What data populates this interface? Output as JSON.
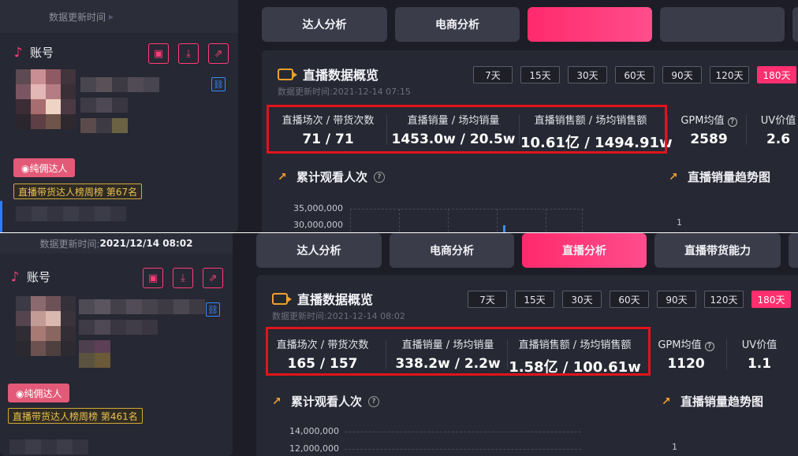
{
  "panels": [
    {
      "update_label": "数据更新时间",
      "update_time": "",
      "account_label": "账号",
      "tag_pink": "◉纯佣达人",
      "tag_gold": "直播带货达人榜周榜 第67名",
      "tabs": [
        "达人分析",
        "电商分析",
        "",
        ""
      ],
      "active_tab": 2,
      "overview_title": "直播数据概览",
      "overview_update": "数据更新时间:2021-12-14 07:15",
      "ranges": [
        "7天",
        "15天",
        "30天",
        "60天",
        "90天",
        "120天",
        "180天"
      ],
      "active_range": 6,
      "metrics": [
        {
          "label": "直播场次 / 带货次数",
          "value": "71 / 71"
        },
        {
          "label": "直播销量 / 场均销量",
          "value": "1453.0w / 20.5w"
        },
        {
          "label": "直播销售额 / 场均销售额",
          "value": "10.61亿 / 1494.91w"
        },
        {
          "label": "GPM均值",
          "value": "2589"
        },
        {
          "label": "UV价值",
          "value": "2.6"
        }
      ],
      "section_left": "累计观看人次",
      "section_right": "直播销量趋势图",
      "y_ticks": [
        "35,000,000",
        "30,000,000"
      ],
      "right_tick": "1"
    },
    {
      "update_label": "数据更新时间:",
      "update_time": "2021/12/14 08:02",
      "account_label": "账号",
      "tag_pink": "◉纯佣达人",
      "tag_gold": "直播带货达人榜周榜 第461名",
      "tabs": [
        "达人分析",
        "电商分析",
        "直播分析",
        "直播带货能力"
      ],
      "active_tab": 2,
      "overview_title": "直播数据概览",
      "overview_update": "数据更新时间:2021-12-14 08:02",
      "ranges": [
        "7天",
        "15天",
        "30天",
        "60天",
        "90天",
        "120天",
        "180天"
      ],
      "active_range": 6,
      "metrics": [
        {
          "label": "直播场次 / 带货次数",
          "value": "165 / 157"
        },
        {
          "label": "直播销量 / 场均销量",
          "value": "338.2w / 2.2w"
        },
        {
          "label": "直播销售额 / 场均销售额",
          "value": "1.58亿 / 100.61w"
        },
        {
          "label": "GPM均值",
          "value": "1120"
        },
        {
          "label": "UV价值",
          "value": "1.1"
        }
      ],
      "section_left": "累计观看人次",
      "section_right": "直播销量趋势图",
      "y_ticks": [
        "14,000,000",
        "12,000,000"
      ],
      "right_tick": "1"
    }
  ],
  "colors": {
    "accent": "#ff2f70",
    "highlight_box": "#e0141c",
    "link": "#3a8cff",
    "gold": "#e9c14e",
    "icon_orange": "#f0a030"
  },
  "icons": {
    "account": "tiktok-icon",
    "actions": [
      "bookmark-icon",
      "download-icon",
      "external-link-icon"
    ],
    "link": "link-icon",
    "overview": "video-camera-icon",
    "section": "trend-chart-icon",
    "help": "question-circle-icon"
  }
}
